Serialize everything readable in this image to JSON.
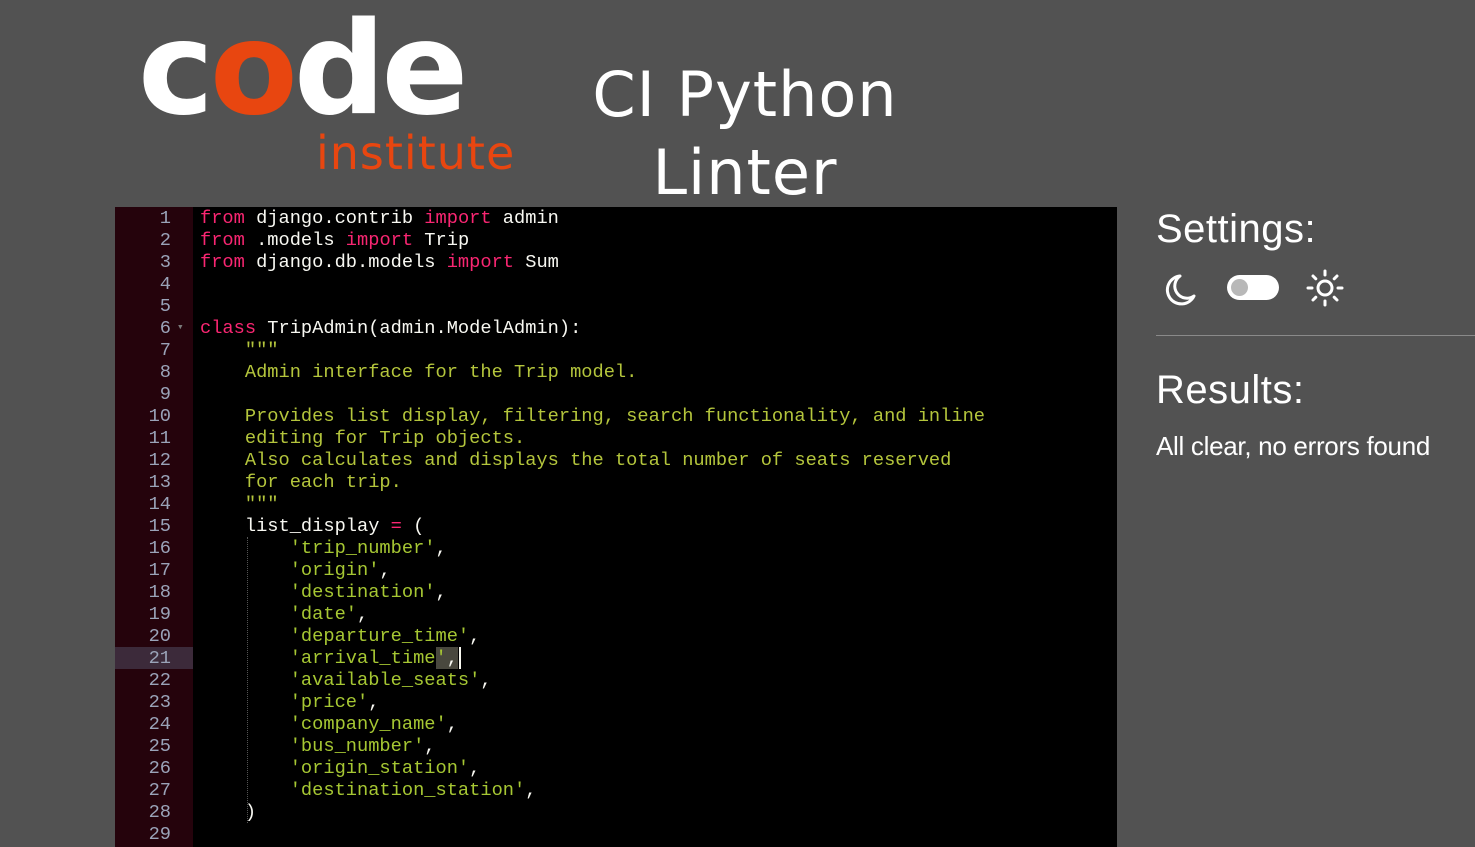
{
  "logo": {
    "word_part1": "c",
    "word_o": "o",
    "word_part2": "de",
    "sub": "institute"
  },
  "app_title": {
    "line1": "CI Python",
    "line2": "Linter"
  },
  "editor": {
    "active_line": 21,
    "fold_line": 6,
    "lines": [
      [
        {
          "t": "from",
          "c": "kw"
        },
        {
          "t": " django.contrib "
        },
        {
          "t": "import",
          "c": "kw"
        },
        {
          "t": " admin"
        }
      ],
      [
        {
          "t": "from",
          "c": "kw"
        },
        {
          "t": " .models "
        },
        {
          "t": "import",
          "c": "kw"
        },
        {
          "t": " Trip"
        }
      ],
      [
        {
          "t": "from",
          "c": "kw"
        },
        {
          "t": " django.db.models "
        },
        {
          "t": "import",
          "c": "kw"
        },
        {
          "t": " Sum"
        }
      ],
      [],
      [],
      [
        {
          "t": "class",
          "c": "kw"
        },
        {
          "t": " TripAdmin(admin.ModelAdmin):"
        }
      ],
      [
        {
          "t": "    "
        },
        {
          "t": "\"\"\"",
          "c": "doc"
        }
      ],
      [
        {
          "t": "    "
        },
        {
          "t": "Admin interface for the Trip model.",
          "c": "doc"
        }
      ],
      [],
      [
        {
          "t": "    "
        },
        {
          "t": "Provides list display, filtering, search functionality, and inline",
          "c": "doc"
        }
      ],
      [
        {
          "t": "    "
        },
        {
          "t": "editing for Trip objects.",
          "c": "doc"
        }
      ],
      [
        {
          "t": "    "
        },
        {
          "t": "Also calculates and displays the total number of seats reserved",
          "c": "doc"
        }
      ],
      [
        {
          "t": "    "
        },
        {
          "t": "for each trip.",
          "c": "doc"
        }
      ],
      [
        {
          "t": "    "
        },
        {
          "t": "\"\"\"",
          "c": "doc"
        }
      ],
      [
        {
          "t": "    list_display "
        },
        {
          "t": "=",
          "c": "op"
        },
        {
          "t": " ("
        }
      ],
      [
        {
          "t": "        "
        },
        {
          "t": "'trip_number'",
          "c": "str"
        },
        {
          "t": ","
        }
      ],
      [
        {
          "t": "        "
        },
        {
          "t": "'origin'",
          "c": "str"
        },
        {
          "t": ","
        }
      ],
      [
        {
          "t": "        "
        },
        {
          "t": "'destination'",
          "c": "str"
        },
        {
          "t": ","
        }
      ],
      [
        {
          "t": "        "
        },
        {
          "t": "'date'",
          "c": "str"
        },
        {
          "t": ","
        }
      ],
      [
        {
          "t": "        "
        },
        {
          "t": "'departure_time'",
          "c": "str"
        },
        {
          "t": ","
        }
      ],
      [
        {
          "t": "        "
        },
        {
          "t": "'arrival_time",
          "c": "str"
        },
        {
          "t": "'",
          "c": "str sel"
        },
        {
          "t": ",",
          "c": "sel"
        },
        {
          "t": "",
          "c": "cursor"
        }
      ],
      [
        {
          "t": "        "
        },
        {
          "t": "'available_seats'",
          "c": "str"
        },
        {
          "t": ","
        }
      ],
      [
        {
          "t": "        "
        },
        {
          "t": "'price'",
          "c": "str"
        },
        {
          "t": ","
        }
      ],
      [
        {
          "t": "        "
        },
        {
          "t": "'company_name'",
          "c": "str"
        },
        {
          "t": ","
        }
      ],
      [
        {
          "t": "        "
        },
        {
          "t": "'bus_number'",
          "c": "str"
        },
        {
          "t": ","
        }
      ],
      [
        {
          "t": "        "
        },
        {
          "t": "'origin_station'",
          "c": "str"
        },
        {
          "t": ","
        }
      ],
      [
        {
          "t": "        "
        },
        {
          "t": "'destination_station'",
          "c": "str"
        },
        {
          "t": ","
        }
      ],
      [
        {
          "t": "    )"
        }
      ],
      []
    ]
  },
  "sidebar": {
    "settings_title": "Settings:",
    "moon_icon": "moon-icon",
    "sun_icon": "sun-icon",
    "theme_toggle_on": false,
    "results_title": "Results:",
    "results_text": "All clear, no errors found"
  }
}
